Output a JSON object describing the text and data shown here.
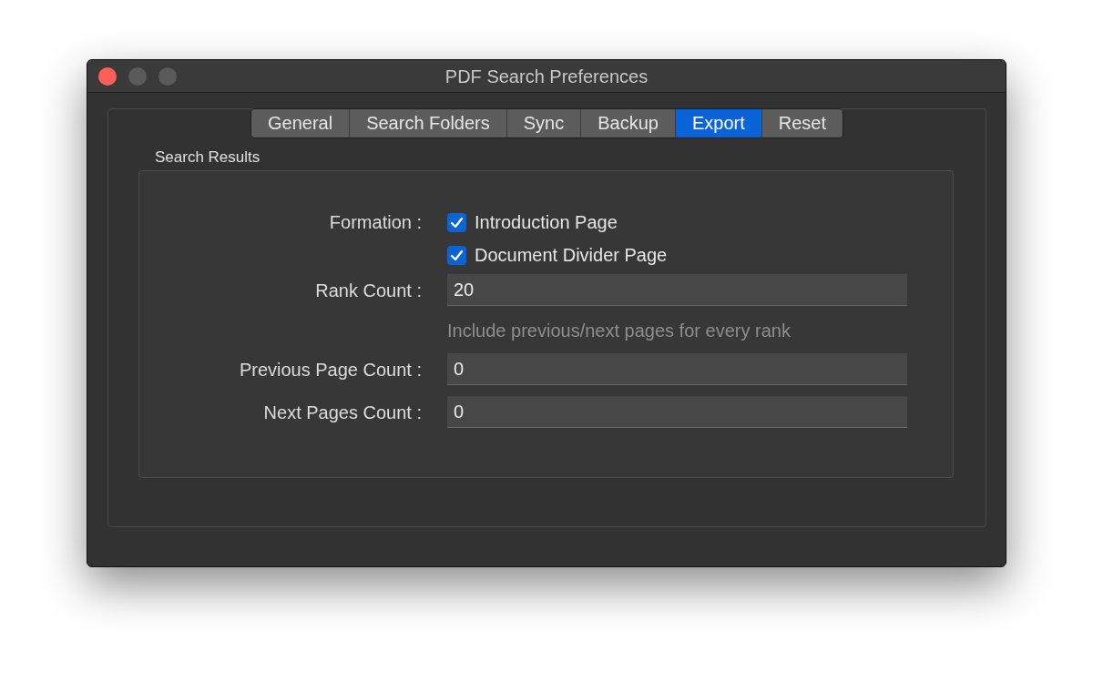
{
  "window": {
    "title": "PDF Search Preferences"
  },
  "tabs": [
    {
      "label": "General",
      "selected": false
    },
    {
      "label": "Search Folders",
      "selected": false
    },
    {
      "label": "Sync",
      "selected": false
    },
    {
      "label": "Backup",
      "selected": false
    },
    {
      "label": "Export",
      "selected": true
    },
    {
      "label": "Reset",
      "selected": false
    }
  ],
  "section": {
    "title": "Search Results"
  },
  "rows": [
    {
      "kind": "checks",
      "label": "Formation :",
      "options": [
        {
          "label": "Introduction Page",
          "checked": true
        },
        {
          "label": "Document Divider Page",
          "checked": true
        }
      ]
    },
    {
      "kind": "field",
      "label": "Rank Count :",
      "value": "20"
    },
    {
      "kind": "hint",
      "text": "Include previous/next pages for every rank"
    },
    {
      "kind": "field",
      "label": "Previous Page Count :",
      "value": "0"
    },
    {
      "kind": "field",
      "label": "Next Pages Count :",
      "value": "0"
    }
  ]
}
